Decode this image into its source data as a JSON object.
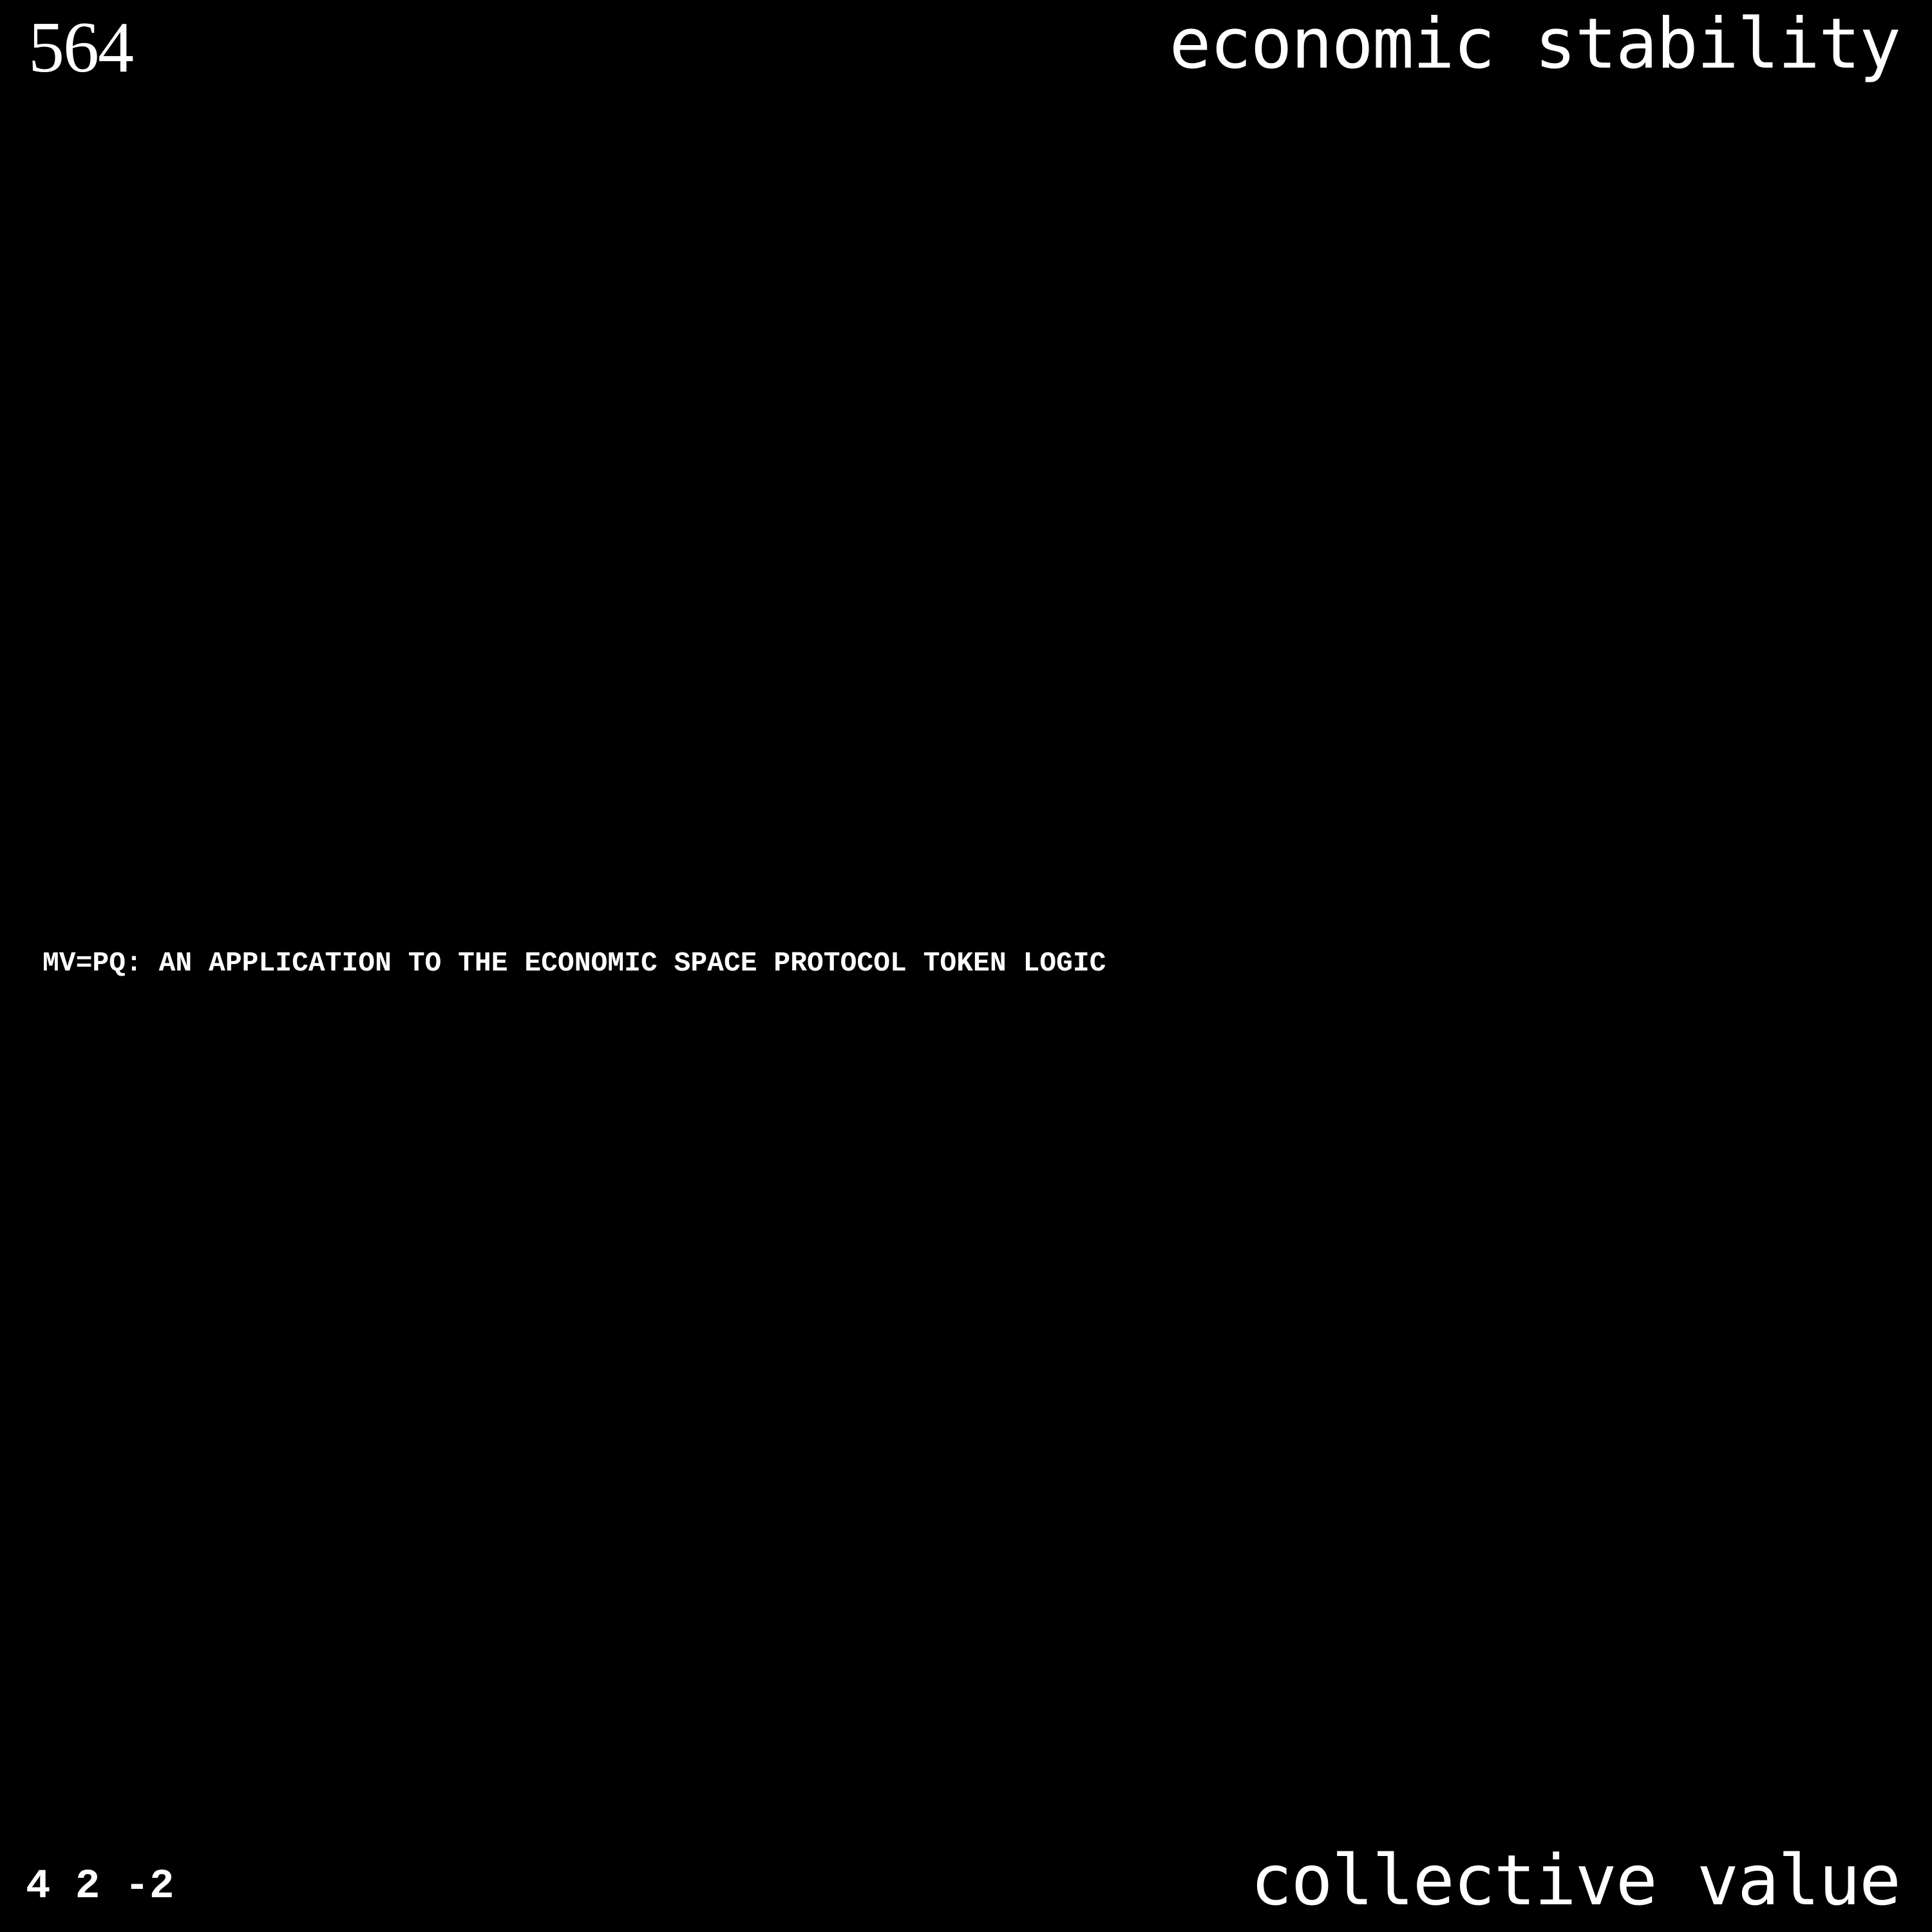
{
  "top_left_number": "564",
  "top_right_text": "economic stability",
  "center_text": "MV=PQ: AN APPLICATION TO THE ECONOMIC SPACE PROTOCOL TOKEN LOGIC",
  "bottom_left_text": "4 2 -2",
  "bottom_right_text": "collective value",
  "colors": {
    "background": "#000000",
    "text": "#ffffff"
  }
}
